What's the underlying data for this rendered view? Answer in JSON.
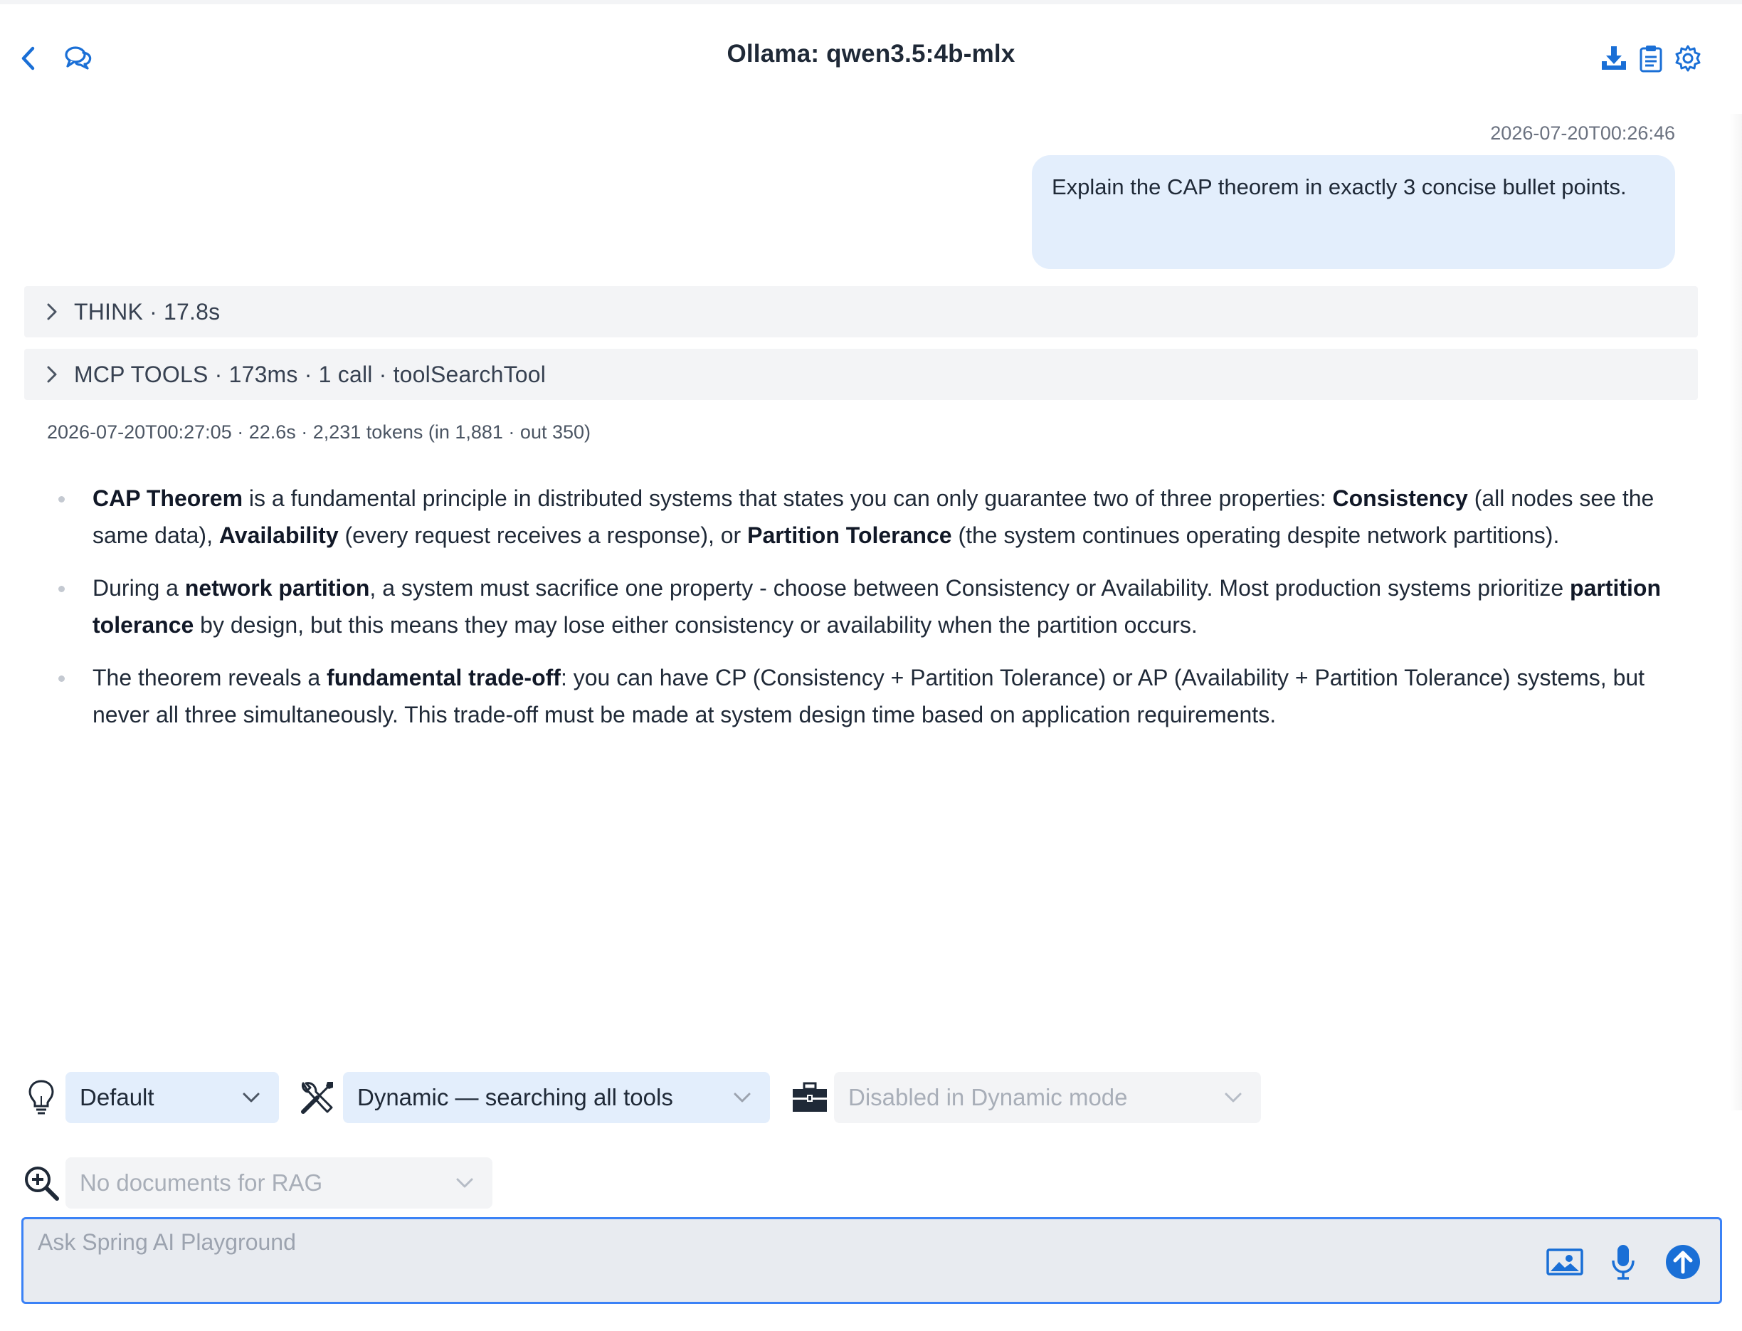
{
  "header": {
    "title": "Ollama: qwen3.5:4b-mlx",
    "back_icon": "chevron-left-icon",
    "chats_icon": "chat-bubbles-icon",
    "actions": [
      "download-icon",
      "clipboard-icon",
      "gear-icon"
    ]
  },
  "user_message": {
    "timestamp": "2026-07-20T00:26:46",
    "text": "Explain the CAP theorem in exactly 3 concise bullet points."
  },
  "sections": {
    "think": "THINK · 17.8s",
    "mcp_tools": "MCP TOOLS · 173ms · 1 call · toolSearchTool"
  },
  "response_meta": "2026-07-20T00:27:05 · 22.6s · 2,231 tokens (in 1,881 · out 350)",
  "answer": {
    "bullets": [
      [
        {
          "b": "CAP Theorem"
        },
        {
          "t": " is a fundamental principle in distributed systems that states you can only guarantee two of three properties: "
        },
        {
          "b": "Consistency"
        },
        {
          "t": " (all nodes see the same data), "
        },
        {
          "b": "Availability"
        },
        {
          "t": " (every request receives a response), or "
        },
        {
          "b": "Partition Tolerance"
        },
        {
          "t": " (the system continues operating despite network partitions)."
        }
      ],
      [
        {
          "t": "During a "
        },
        {
          "b": "network partition"
        },
        {
          "t": ", a system must sacrifice one property - choose between Consistency or Availability. Most production systems prioritize "
        },
        {
          "b": "partition tolerance"
        },
        {
          "t": " by design, but this means they may lose either consistency or availability when the partition occurs."
        }
      ],
      [
        {
          "t": "The theorem reveals a "
        },
        {
          "b": "fundamental trade-off"
        },
        {
          "t": ": you can have CP (Consistency + Partition Tolerance) or AP (Availability + Partition Tolerance) systems, but never all three simultaneously. This trade-off must be made at system design time based on application requirements."
        }
      ]
    ]
  },
  "controls": {
    "reasoning_select": "Default",
    "tools_mode_select": "Dynamic — searching all tools",
    "toolset_select": "Disabled in Dynamic mode",
    "rag_select": "No documents for RAG"
  },
  "input": {
    "placeholder": "Ask Spring AI Playground",
    "value": ""
  },
  "colors": {
    "accent": "#1a6fd6",
    "bubble": "#e3eefc",
    "row_bg": "#f3f4f6",
    "input_border": "#3b82f6"
  }
}
